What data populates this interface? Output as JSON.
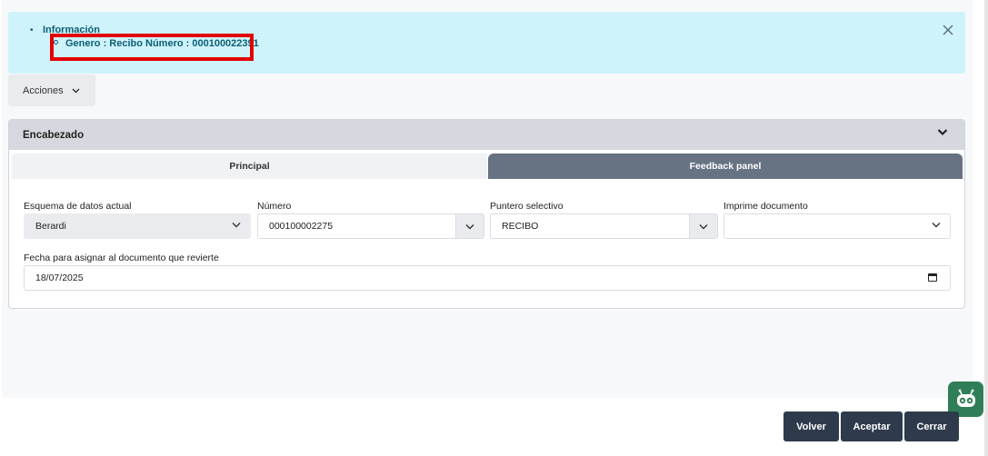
{
  "alert": {
    "title": "Información",
    "message": "Genero : Recibo Número : 000100022391",
    "close_icon": "close-icon"
  },
  "actions": {
    "label": "Acciones"
  },
  "card": {
    "title": "Encabezado",
    "tabs": [
      {
        "label": "Principal",
        "active": false
      },
      {
        "label": "Feedback panel",
        "active": true
      }
    ]
  },
  "form": {
    "esquema": {
      "label": "Esquema de datos actual",
      "value": "Berardi"
    },
    "numero": {
      "label": "Número",
      "value": "000100002275"
    },
    "puntero": {
      "label": "Puntero selectivo",
      "value": "RECIBO"
    },
    "imprime": {
      "label": "Imprime documento",
      "value": ""
    },
    "fecha": {
      "label": "Fecha para asignar al documento que revierte",
      "value": "18/07/2025"
    }
  },
  "footer": {
    "volver": "Volver",
    "aceptar": "Aceptar",
    "cerrar": "Cerrar"
  },
  "colors": {
    "alert_bg": "#cff3fb",
    "highlight": "#e20000",
    "active_tab": "#677283",
    "button": "#2f3b4c",
    "assistant": "#2f7e57"
  }
}
